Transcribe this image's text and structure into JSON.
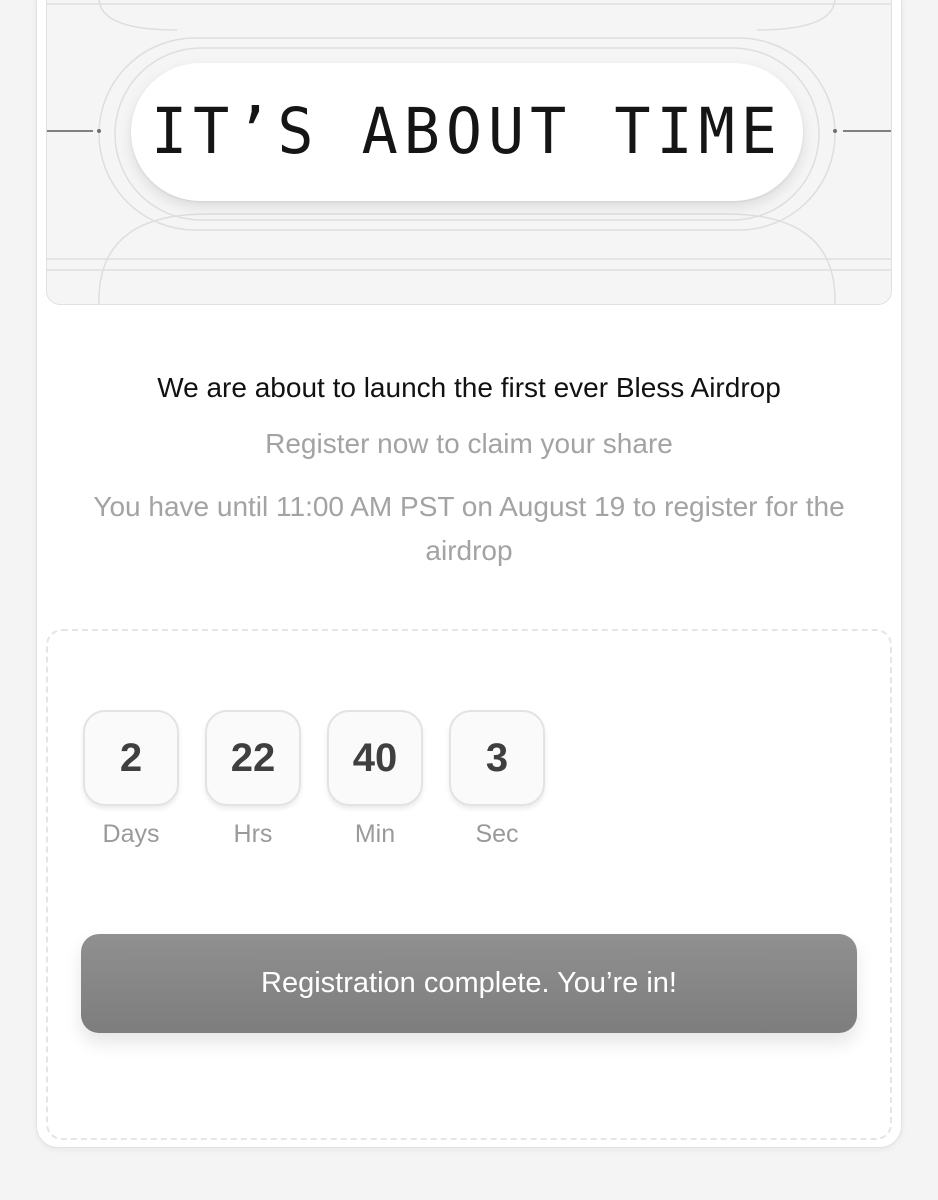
{
  "hero": {
    "title": "IT’S ABOUT TIME"
  },
  "intro": {
    "headline": "We are about to launch the first ever Bless Airdrop",
    "subtitle": "Register now to claim your share",
    "deadline_text": "You have until 11:00 AM PST on August 19 to register for the airdrop"
  },
  "countdown": [
    {
      "value": "2",
      "label": "Days"
    },
    {
      "value": "22",
      "label": "Hrs"
    },
    {
      "value": "40",
      "label": "Min"
    },
    {
      "value": "3",
      "label": "Sec"
    }
  ],
  "cta": {
    "label": "Registration complete. You’re in!"
  },
  "colors": {
    "button": "#888888",
    "card": "#ffffff",
    "background": "#f4f4f4"
  }
}
